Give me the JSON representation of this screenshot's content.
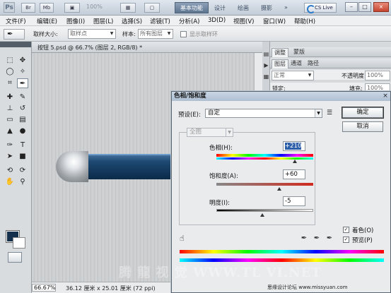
{
  "titlebar": {
    "logo": "Ps",
    "br": "Br",
    "mb": "Mb",
    "zoom": "100%",
    "workspace": "基本功能",
    "design": "设计",
    "paint": "绘画",
    "photo": "摄影",
    "more": "»",
    "cslive": "CS Live",
    "min": "–",
    "max": "□",
    "close": "×"
  },
  "menubar": {
    "items": [
      "文件(F)",
      "编辑(E)",
      "图像(I)",
      "图层(L)",
      "选择(S)",
      "滤镜(T)",
      "分析(A)",
      "3D(D)",
      "视图(V)",
      "窗口(W)",
      "帮助(H)"
    ]
  },
  "options": {
    "sample_size_label": "取样大小:",
    "sample_size_value": "取样点",
    "sample_label": "样本:",
    "sample_value": "所有图层",
    "show_ring_label": "显示取样环"
  },
  "document": {
    "tab_label": "按钮 5.psd @ 66.7% (图层 2, RGB/8) *",
    "zoom": "66.67%",
    "info": "36.12 厘米 x 25.01 厘米 (72 ppi)"
  },
  "panels": {
    "tabs_top": [
      "调整",
      "蒙版"
    ],
    "tabs_layers": [
      "图层",
      "通道",
      "路径"
    ],
    "blend_mode": "正常",
    "opacity_label": "不透明度:",
    "opacity_value": "100%",
    "lock_label": "锁定:",
    "fill_label": "填充:",
    "fill_value": "100%"
  },
  "dialog": {
    "title": "色相/饱和度",
    "preset_label": "预设(E):",
    "preset_value": "自定",
    "ok": "确定",
    "cancel": "取消",
    "channel": "全图",
    "hue_label": "色相(H):",
    "hue_value": "+210",
    "sat_label": "饱和度(A):",
    "sat_value": "+60",
    "light_label": "明度(I):",
    "light_value": "-5",
    "colorize_label": "着色(O)",
    "preview_label": "预览(P)",
    "hue_slider_fraction": 0.81,
    "sat_slider_fraction": 0.65,
    "light_slider_fraction": 0.475
  },
  "watermark": {
    "text": "腾 龍 视 觉 WWW.TL VI.NET",
    "credit": "思缘设计论坛 www.missyuan.com"
  },
  "colors": {
    "foreground": "#14304d",
    "background": "#ffffff",
    "bar_blue": "#1f4a73"
  }
}
